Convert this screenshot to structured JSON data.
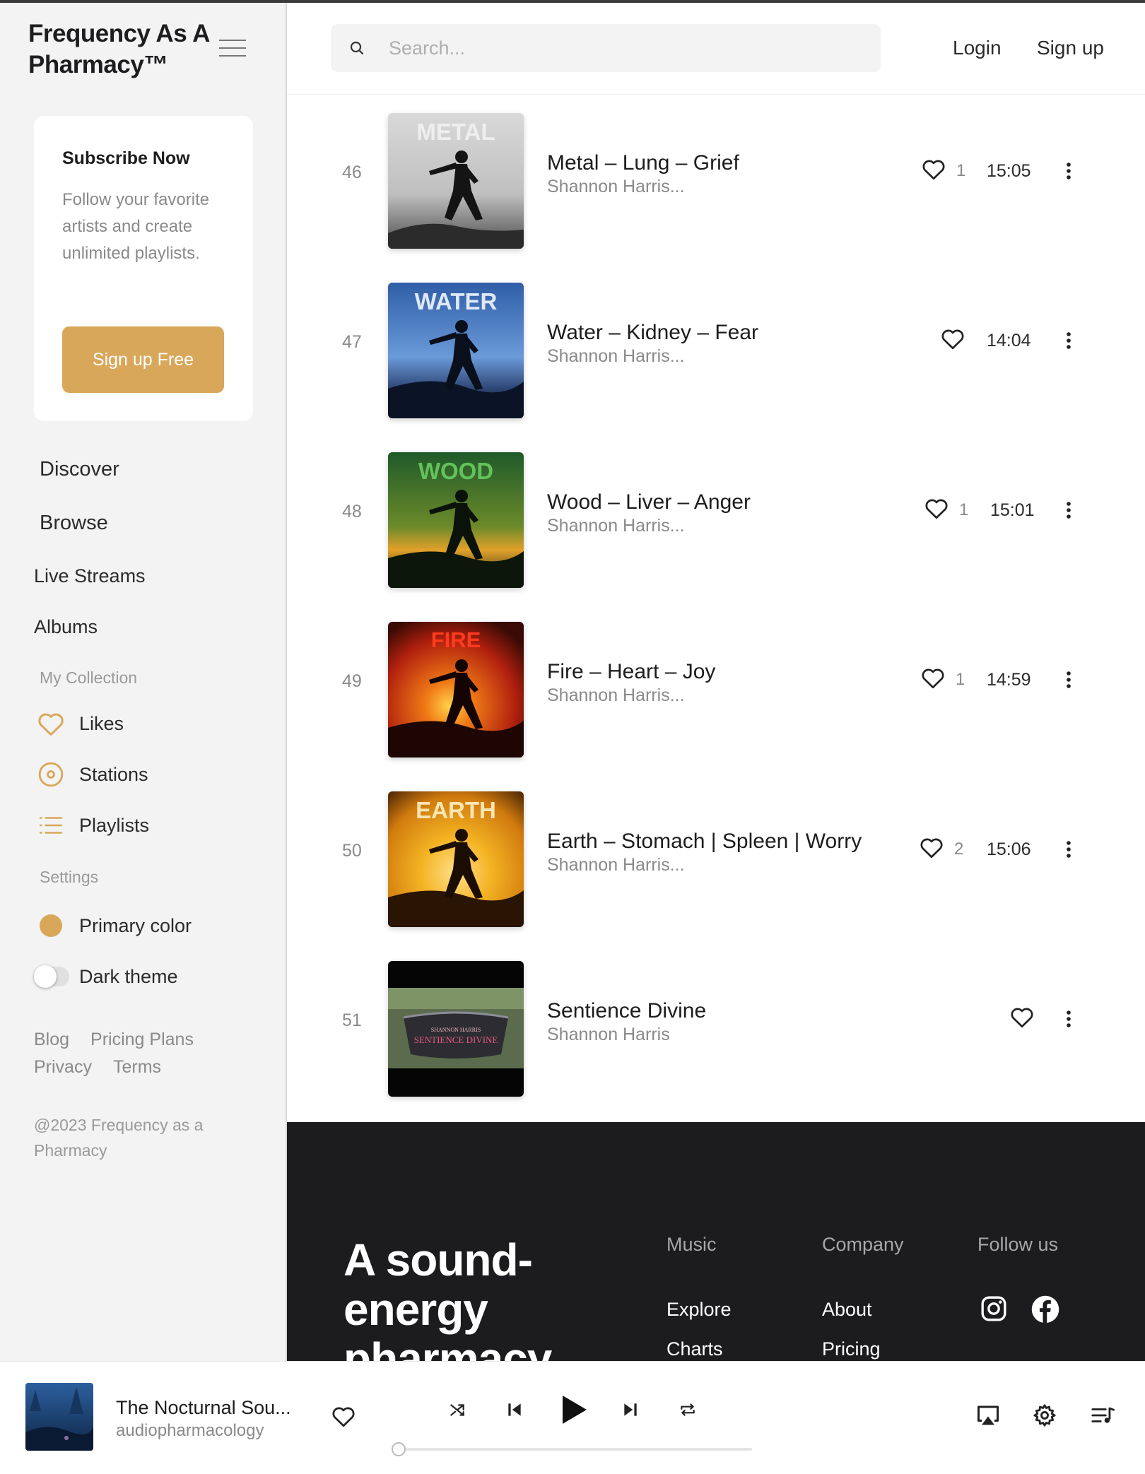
{
  "brand": {
    "name": "Frequency As A Pharmacy™"
  },
  "subscribe": {
    "title": "Subscribe Now",
    "text": "Follow your favorite artists and create unlimited playlists.",
    "button": "Sign up Free"
  },
  "nav": {
    "discover": "Discover",
    "browse": "Browse",
    "live_streams": "Live Streams",
    "albums": "Albums",
    "my_collection": "My Collection",
    "likes": "Likes",
    "stations": "Stations",
    "playlists": "Playlists",
    "settings": "Settings",
    "primary_color": "Primary color",
    "dark_theme": "Dark theme"
  },
  "sidebar_footer": {
    "blog": "Blog",
    "pricing_plans": "Pricing Plans",
    "privacy": "Privacy",
    "terms": "Terms",
    "copyright": "@2023 Frequency as a Pharmacy"
  },
  "header": {
    "search_placeholder": "Search...",
    "login": "Login",
    "signup": "Sign up"
  },
  "tracks": [
    {
      "num": "46",
      "title": "Metal – Lung – Grief",
      "artist": "Shannon Harris...",
      "likes": "1",
      "duration": "15:05",
      "cover_label": "METAL"
    },
    {
      "num": "47",
      "title": "Water – Kidney – Fear",
      "artist": "Shannon Harris...",
      "likes": "",
      "duration": "14:04",
      "cover_label": "WATER"
    },
    {
      "num": "48",
      "title": " Wood – Liver – Anger",
      "artist": "Shannon Harris...",
      "likes": "1",
      "duration": "15:01",
      "cover_label": "WOOD"
    },
    {
      "num": "49",
      "title": "Fire – Heart – Joy",
      "artist": "Shannon Harris...",
      "likes": "1",
      "duration": "14:59",
      "cover_label": "FIRE"
    },
    {
      "num": "50",
      "title": "Earth – Stomach | Spleen | Worry",
      "artist": "Shannon Harris...",
      "likes": "2",
      "duration": "15:06",
      "cover_label": "EARTH"
    },
    {
      "num": "51",
      "title": "Sentience Divine",
      "artist": "Shannon Harris",
      "likes": "",
      "duration": "",
      "cover_label": "SHANNON HARRIS",
      "cover_label2": "SENTIENCE DIVINE"
    }
  ],
  "footer": {
    "tagline": "A sound-energy pharmacy",
    "music_heading": "Music",
    "company_heading": "Company",
    "follow_heading": "Follow us",
    "explore": "Explore",
    "charts": "Charts",
    "about": "About",
    "pricing": "Pricing"
  },
  "player": {
    "title": "The Nocturnal Sou...",
    "artist": "audiopharmacology",
    "progress": 0
  },
  "colors": {
    "primary": "#d9a75a",
    "footer_bg": "#1c1c1e"
  },
  "icons": [
    "menu-icon",
    "search-icon",
    "heart-icon",
    "station-icon",
    "playlist-icon",
    "more-icon",
    "instagram-icon",
    "facebook-icon",
    "shuffle-icon",
    "previous-icon",
    "play-icon",
    "next-icon",
    "repeat-icon",
    "airplay-icon",
    "settings-icon",
    "queue-icon"
  ]
}
